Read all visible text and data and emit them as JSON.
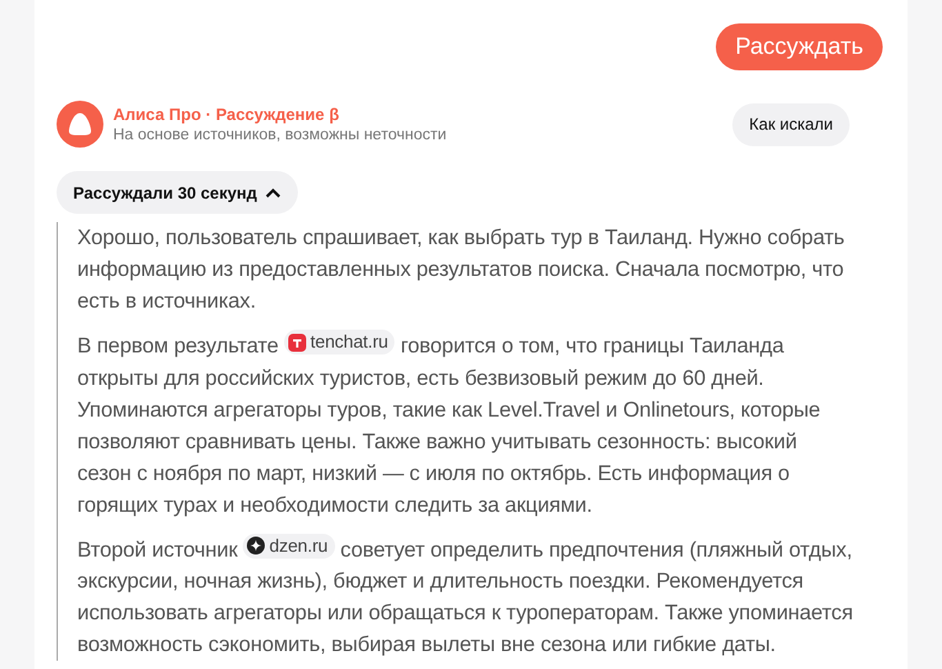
{
  "action_button": {
    "label": "Рассуждать"
  },
  "answer_header": {
    "title": "Алиса Про · Рассуждение β",
    "subtitle": "На основе источников, возможны неточности",
    "search_button": "Как искали"
  },
  "reasoning_toggle": {
    "label": "Рассуждали 30 секунд",
    "expanded": true
  },
  "paragraphs": [
    [
      {
        "kind": "text",
        "text": "Хорошо, пользователь спрашивает, как выбрать тур в Таиланд. Нужно собрать информацию из предоставленных результатов поиска. Сначала посмотрю, что есть в источниках."
      }
    ],
    [
      {
        "kind": "text",
        "text": "В первом результате "
      },
      {
        "kind": "source",
        "label": "tenchat.ru"
      },
      {
        "kind": "text",
        "text": " говорится о том, что границы Таиланда открыты для российских туристов, есть безвизовый режим до 60 дней. Упоминаются агрегаторы туров, такие как Level.Travel и Onlinetours, которые позволяют сравнивать цены. Также важно учитывать сезонность: высокий сезон с ноября по март, низкий — с июля по октябрь. Есть информация о горящих турах и необходимости следить за акциями."
      }
    ],
    [
      {
        "kind": "text",
        "text": "Второй источник "
      },
      {
        "kind": "source",
        "label": "dzen.ru"
      },
      {
        "kind": "text",
        "text": " советует определить предпочтения (пляжный отдых, экскурсии, ночная жизнь), бюджет и длительность поездки. Рекомендуется использовать агрегаторы или обращаться к туроператорам. Также упоминается возможность сэкономить, выбирая вылеты вне сезона или гибкие даты."
      }
    ]
  ]
}
